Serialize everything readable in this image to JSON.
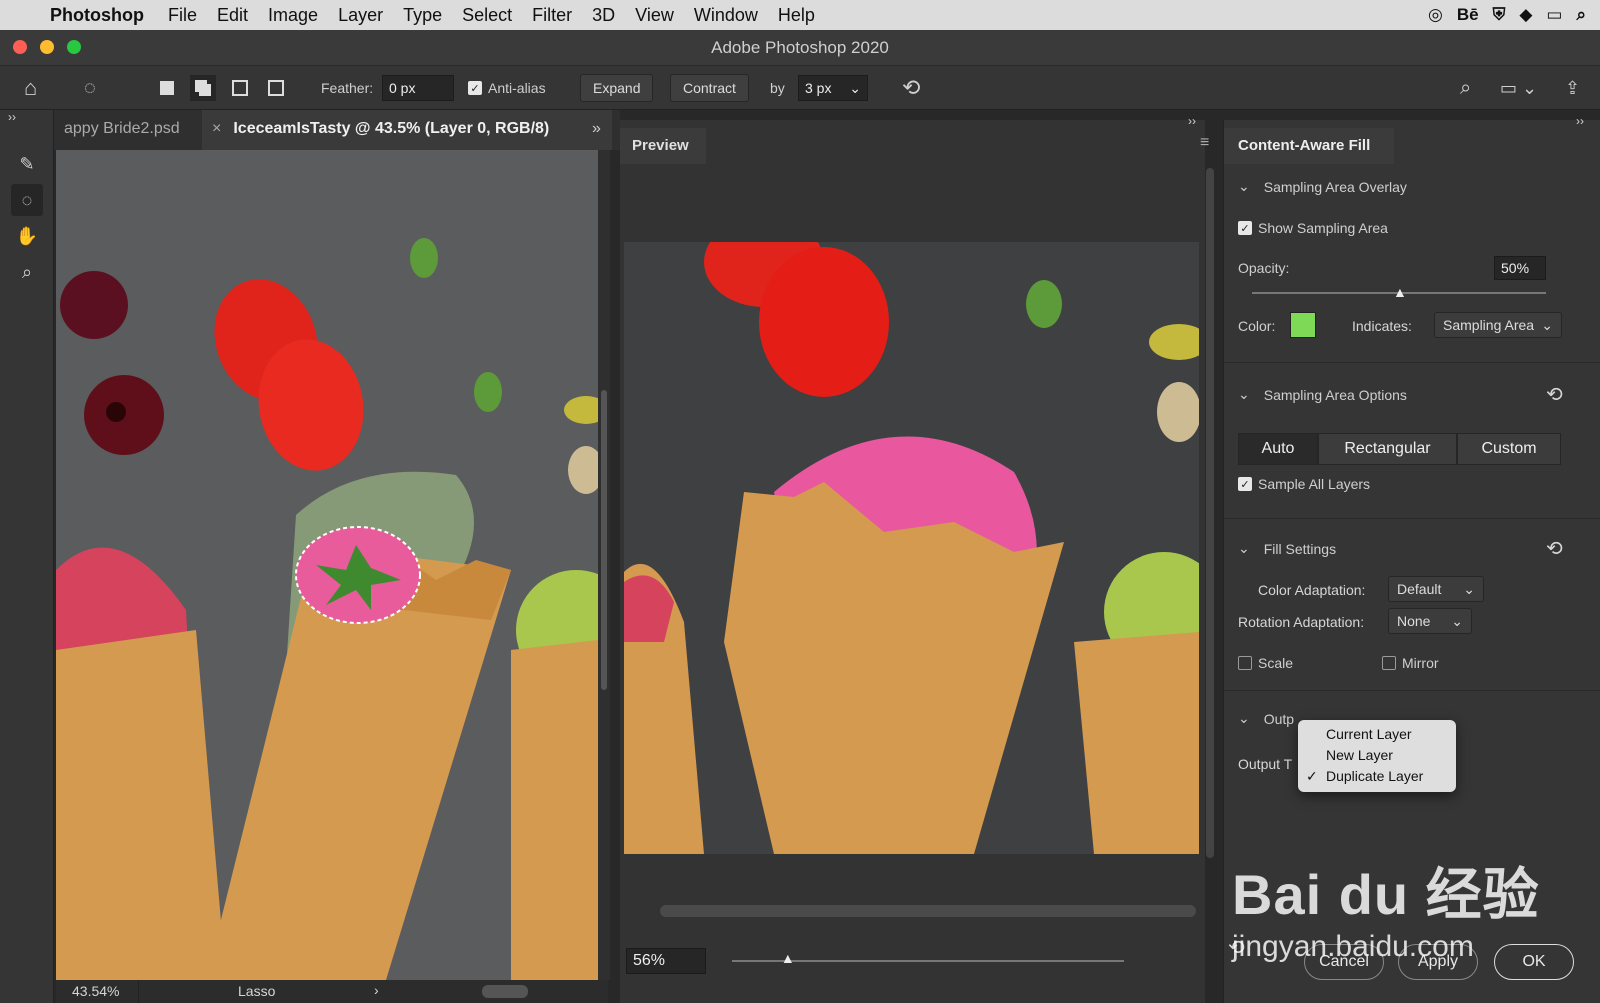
{
  "menubar": {
    "app": "Photoshop",
    "items": [
      "File",
      "Edit",
      "Image",
      "Layer",
      "Type",
      "Select",
      "Filter",
      "3D",
      "View",
      "Window",
      "Help"
    ]
  },
  "window": {
    "title": "Adobe Photoshop 2020"
  },
  "options": {
    "feather_label": "Feather:",
    "feather_value": "0 px",
    "antialias_label": "Anti-alias",
    "expand": "Expand",
    "contract": "Contract",
    "by_label": "by",
    "by_value": "3 px"
  },
  "tabs": {
    "tab1": "appy Bride2.psd",
    "tab2": "IceceamIsTasty @ 43.5% (Layer 0, RGB/8)"
  },
  "status": {
    "zoom": "43.54%",
    "tool": "Lasso"
  },
  "preview": {
    "tab": "Preview",
    "zoom": "56%",
    "zoom_fraction": 0.14
  },
  "panel": {
    "title": "Content-Aware Fill",
    "overlay": {
      "header": "Sampling Area Overlay",
      "show": "Show Sampling Area",
      "opacity_label": "Opacity:",
      "opacity_value": "50%",
      "opacity_fraction": 0.5,
      "color_label": "Color:",
      "color": "#7ed957",
      "indicates_label": "Indicates:",
      "indicates_value": "Sampling Area"
    },
    "sampling": {
      "header": "Sampling Area Options",
      "auto": "Auto",
      "rect": "Rectangular",
      "custom": "Custom",
      "all_layers": "Sample All Layers"
    },
    "fill": {
      "header": "Fill Settings",
      "color_adapt_label": "Color Adaptation:",
      "color_adapt_value": "Default",
      "rot_adapt_label": "Rotation Adaptation:",
      "rot_adapt_value": "None",
      "scale": "Scale",
      "mirror": "Mirror"
    },
    "output": {
      "header": "Outp",
      "label": "Output T",
      "options": [
        "Current Layer",
        "New Layer",
        "Duplicate Layer"
      ],
      "selected": "Duplicate Layer"
    }
  },
  "footer": {
    "cancel": "Cancel",
    "apply": "Apply",
    "ok": "OK"
  },
  "watermark": {
    "logo": "Bai du 经验",
    "url": "jingyan.baidu.com"
  }
}
